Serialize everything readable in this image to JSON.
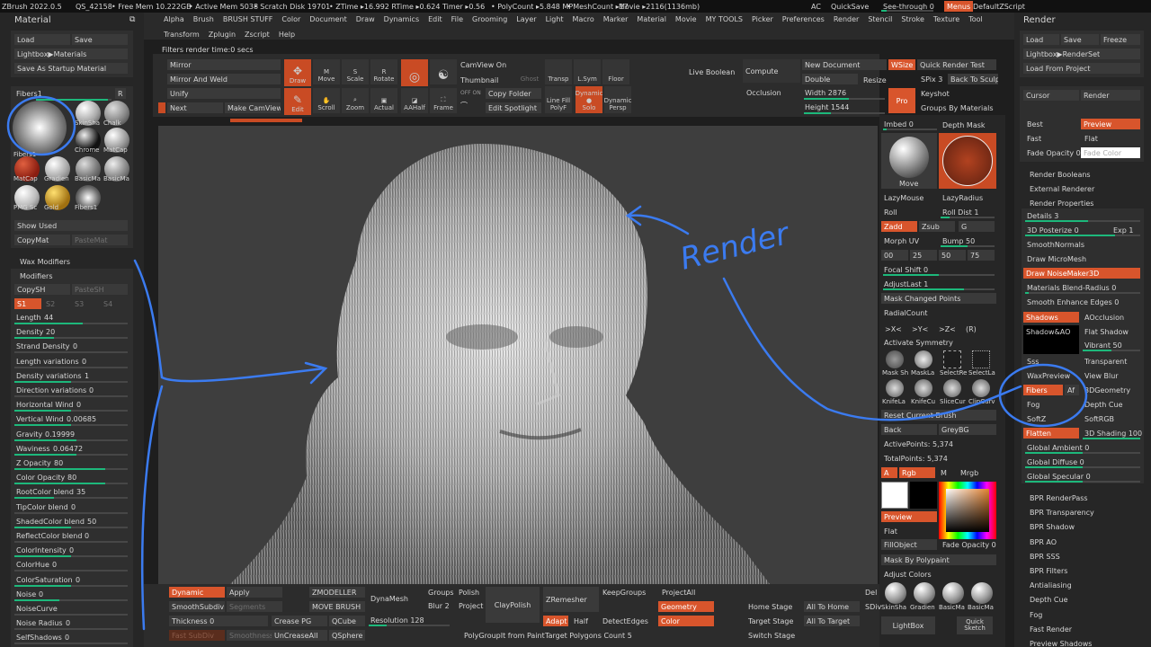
{
  "topbar": {
    "app": "ZBrush 2022.0.5",
    "qs": "QS_42158",
    "free_mem": "• Free Mem 10.222GB",
    "active_mem": "• Active Mem 5038",
    "scratch": "• Scratch Disk 19701",
    "ztime": "• ZTime ▸16.992 RTime ▸0.624 Timer ▸0.56",
    "poly": "• PolyCount ▸5.848 MP",
    "mesh": "• MeshCount ▸17",
    "movie": "Movie ▸2116(1136mb)",
    "ac": "AC",
    "quicksave": "QuickSave",
    "seethrough": "See-through 0",
    "menus": "Menus",
    "script": "DefaultZScript"
  },
  "menus": {
    "row1": [
      "Alpha",
      "Brush",
      "BRUSH STUFF",
      "Color",
      "Document",
      "Draw",
      "Dynamics",
      "Edit",
      "File",
      "Grooming",
      "Layer",
      "Light",
      "Macro",
      "Marker",
      "Material",
      "Movie",
      "MY TOOLS",
      "Picker",
      "Preferences",
      "Render",
      "Stencil",
      "Stroke",
      "Texture",
      "Tool"
    ],
    "row2": [
      "Transform",
      "Zplugin",
      "Zscript",
      "Help"
    ]
  },
  "status": "Filters render time:0 secs",
  "left": {
    "title": "Material",
    "load": "Load",
    "save": "Save",
    "lightbox": "Lightbox▶Materials",
    "startup": "Save As Startup Material",
    "fibers_label": "Fibers1",
    "fibers_r": "R",
    "mats": [
      "Fibers1",
      "SkinSha",
      "Chalk",
      "",
      "Chrome",
      "MatCap",
      "MatCap",
      "Gradien",
      "BasicMa",
      "BasicMa",
      "PMG Sc",
      "Gold",
      "Fibers1"
    ],
    "show_used": "Show Used",
    "copymat": "CopyMat",
    "pastemat": "PasteMat",
    "wax": "Wax Modifiers",
    "modifiers": "Modifiers",
    "copysh": "CopySH",
    "pastesh": "PasteSH",
    "s_tabs": [
      "S1",
      "S2",
      "S3",
      "S4"
    ],
    "params": [
      {
        "label": "Length",
        "value": "44",
        "fill": 0.6
      },
      {
        "label": "Density",
        "value": "20",
        "fill": 0.35
      },
      {
        "label": "Strand Density",
        "value": "0",
        "fill": 0.0
      },
      {
        "label": "Length variations",
        "value": "0",
        "fill": 0.0
      },
      {
        "label": "Density variations",
        "value": "1",
        "fill": 0.5
      },
      {
        "label": "Direction variations",
        "value": "0",
        "fill": 0.0
      },
      {
        "label": "Horizontal Wind",
        "value": "0",
        "fill": 0.5
      },
      {
        "label": "Vertical Wind",
        "value": "0.00685",
        "fill": 0.5
      },
      {
        "label": "Gravity",
        "value": "0.19999",
        "fill": 0.55
      },
      {
        "label": "Waviness",
        "value": "0.06472",
        "fill": 0.55
      },
      {
        "label": "Z Opacity",
        "value": "80",
        "fill": 0.8
      },
      {
        "label": "Color Opacity",
        "value": "80",
        "fill": 0.8
      },
      {
        "label": "RootColor blend",
        "value": "35",
        "fill": 0.35
      },
      {
        "label": "TipColor blend",
        "value": "0",
        "fill": 0.0
      },
      {
        "label": "ShadedColor blend",
        "value": "50",
        "fill": 0.5
      },
      {
        "label": "ReflectColor blend",
        "value": "0",
        "fill": 0.0
      },
      {
        "label": "ColorIntensity",
        "value": "0",
        "fill": 0.5
      },
      {
        "label": "ColorHue",
        "value": "0",
        "fill": 0.0
      },
      {
        "label": "ColorSaturation",
        "value": "0",
        "fill": 0.5
      },
      {
        "label": "Noise",
        "value": "0",
        "fill": 0.4
      },
      {
        "label": "NoiseCurve",
        "value": "",
        "fill": 0.0
      },
      {
        "label": "Noise Radius",
        "value": "0",
        "fill": 0.0
      },
      {
        "label": "SelfShadows",
        "value": "0",
        "fill": 0.0
      }
    ]
  },
  "toolbar": {
    "mirror": "Mirror",
    "mirror_weld": "Mirror And Weld",
    "unify": "Unify",
    "next": "Next",
    "make_camview": "Make CamView",
    "draw": "Draw",
    "edit": "Edit",
    "move": "Move",
    "scroll": "Scroll",
    "scale": "Scale",
    "zoom": "Zoom",
    "rotate": "Rotate",
    "actual": "Actual",
    "aahalf": "AAHalf",
    "frame": "Frame",
    "camview_on": "CamView On",
    "thumbnail": "Thumbnail",
    "copy_folder": "Copy Folder",
    "edit_spotlight": "Edit Spotlight",
    "ghost": "Ghost",
    "transp": "Transp",
    "lsym": "L.Sym",
    "floor": "Floor",
    "linefill": "Line Fill",
    "polyf": "PolyF",
    "dynamic": "Dynamic",
    "solo": "Solo",
    "persp": "Persp",
    "live_boolean": "Live Boolean",
    "compute": "Compute",
    "occlusion": "Occlusion",
    "new_doc": "New Document",
    "double": "Double",
    "width": "Width 2876",
    "height": "Height 1544",
    "wsize": "WSize",
    "resize": "Resize",
    "pro": "Pro",
    "quick_render": "Quick Render Test",
    "spix": "SPix 3",
    "back_sculp": "Back To Sculp",
    "keyshot": "Keyshot",
    "groups_mat": "Groups By Materials"
  },
  "right": {
    "title": "Render",
    "load": "Load",
    "save": "Save",
    "freeze": "Freeze",
    "lightbox": "Lightbox▶RenderSet",
    "load_project": "Load From Project",
    "cursor": "Cursor",
    "render": "Render",
    "best": "Best",
    "preview": "Preview",
    "fast": "Fast",
    "flat": "Flat",
    "fade_opacity": "Fade Opacity 0",
    "fade_color": "Fade Color",
    "render_booleans": "Render Booleans",
    "external": "External Renderer",
    "render_props": "Render Properties",
    "details": "Details 3",
    "posterize": "3D Posterize 0",
    "exp": "Exp 1",
    "smoothnormals": "SmoothNormals",
    "micromesh": "Draw MicroMesh",
    "noisemaker": "Draw NoiseMaker3D",
    "blend_radius": "Materials Blend-Radius 0",
    "smooth_edges": "Smooth Enhance Edges 0",
    "shadows": "Shadows",
    "aocclusion": "AOcclusion",
    "shadow_ao": "Shadow&AO",
    "flat_shadow": "Flat Shadow",
    "vibrant": "Vibrant 50",
    "sss": "Sss",
    "transparent": "Transparent",
    "waxpreview": "WaxPreview",
    "view_blur": "View Blur",
    "fibers": "Fibers",
    "af": "Af",
    "dgeometry": "3DGeometry",
    "fog": "Fog",
    "depth_cue": "Depth Cue",
    "softz": "SoftZ",
    "softrgb": "SoftRGB",
    "flatten": "Flatten",
    "shading": "3D Shading 100",
    "global_ambient": "Global Ambient 0",
    "global_diffuse": "Global Diffuse 0",
    "global_specular": "Global Specular 0",
    "bpr_list": [
      "BPR RenderPass",
      "BPR Transparency",
      "BPR Shadow",
      "BPR AO",
      "BPR SSS",
      "BPR Filters",
      "Antialiasing",
      "Depth Cue",
      "Fog",
      "Fast Render",
      "Preview Shadows"
    ]
  },
  "shelf": {
    "imbed": "Imbed 0",
    "depth_mask": "Depth Mask",
    "move": "Move",
    "lazymouse": "LazyMouse",
    "lazyradius": "LazyRadius",
    "roll": "Roll",
    "roll_dist": "Roll Dist 1",
    "zadd": "Zadd",
    "zsub": "Zsub",
    "g": "G",
    "morph_uv": "Morph UV",
    "bump": "Bump 50",
    "nums": [
      "00",
      "25",
      "50",
      "75"
    ],
    "focal_shift": "Focal Shift 0",
    "adjustlast": "AdjustLast 1",
    "mask_changed": "Mask Changed Points",
    "radialcount": "RadialCount",
    "axes": [
      ">X<",
      ">Y<",
      ">Z<",
      "(R)"
    ],
    "activate_sym": "Activate Symmetry",
    "tools1": [
      "Mask Sh",
      "MaskLa",
      "SelectRe",
      "SelectLa"
    ],
    "tools2": [
      "KnifeLa",
      "KnifeCu",
      "SliceCur",
      "ClipCurv"
    ],
    "reset_brush": "Reset Current Brush",
    "back": "Back",
    "greybg": "GreyBG",
    "active_points": "ActivePoints: 5,374",
    "total_points": "TotalPoints: 5,374",
    "a": "A",
    "rgb": "Rgb",
    "m": "M",
    "mrgb": "Mrgb",
    "preview": "Preview",
    "flat": "Flat",
    "fillobject": "FillObject",
    "fade_opacity": "Fade Opacity 0",
    "mask_polypaint": "Mask By Polypaint",
    "adjust_colors": "Adjust Colors"
  },
  "bottom": {
    "dynamic": "Dynamic",
    "apply": "Apply",
    "smoothsubdiv": "SmoothSubdiv",
    "segments": "Segments",
    "thickness": "Thickness 0",
    "fastsubdiv": "Fast SubDiv",
    "smoothness": "Smoothness",
    "zmodeller": "ZMODELLER",
    "move_brush": "MOVE BRUSH",
    "crease_pg": "Crease PG",
    "qcube": "QCube",
    "uncrease_all": "UnCreaseAll",
    "qsphere": "QSphere",
    "dynamesh": "DynaMesh",
    "groups": "Groups",
    "polish": "Polish",
    "blur": "Blur 2",
    "project": "Project",
    "resolution": "Resolution 128",
    "claypolish": "ClayPolish",
    "polygroupit": "PolyGroupIt from Paint",
    "zremesher": "ZRemesher",
    "adapt": "Adapt",
    "half": "Half",
    "target_polys": "Target Polygons Count 5",
    "keepgroups": "KeepGroups",
    "detectedges": "DetectEdges",
    "projectall": "ProjectAll",
    "geometry": "Geometry",
    "color": "Color",
    "home_stage": "Home Stage",
    "target_stage": "Target Stage",
    "switch_stage": "Switch Stage",
    "all_home": "All To Home",
    "all_target": "All To Target",
    "del": "Del",
    "sdiv": "SDiv",
    "mats": [
      "SkinSha",
      "Gradien",
      "BasicMa",
      "BasicMa"
    ],
    "lightbox": "LightBox",
    "quick_sketch": "Quick Sketch"
  },
  "annotation": "Render",
  "colors": {
    "accent": "#d8552c",
    "slider": "#1db87b",
    "annotation": "#3b7bf0"
  }
}
